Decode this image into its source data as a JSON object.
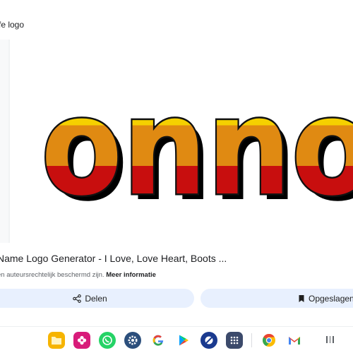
{
  "page": {
    "top_label": "fe logo"
  },
  "image": {
    "logo_text": "onno",
    "colors": {
      "yellow": "#f5d000",
      "orange": "#e08a12",
      "red": "#c80e0e",
      "outline": "#111111",
      "shadow": "#000000"
    }
  },
  "result": {
    "title": "Name Logo Generator - I Love, Love Heart, Boots ...",
    "copyright_text": "en auteursrechtelijk beschermd zijn.",
    "more_info_label": "Meer informatie"
  },
  "actions": {
    "share_label": "Delen",
    "saved_label": "Opgeslagen"
  },
  "dock": {
    "apps": [
      "files-icon",
      "gallery-flower-icon",
      "whatsapp-icon",
      "settings-icon",
      "google-icon",
      "play-store-icon",
      "clock-icon",
      "app-drawer-icon",
      "chrome-icon",
      "gmail-icon"
    ]
  }
}
